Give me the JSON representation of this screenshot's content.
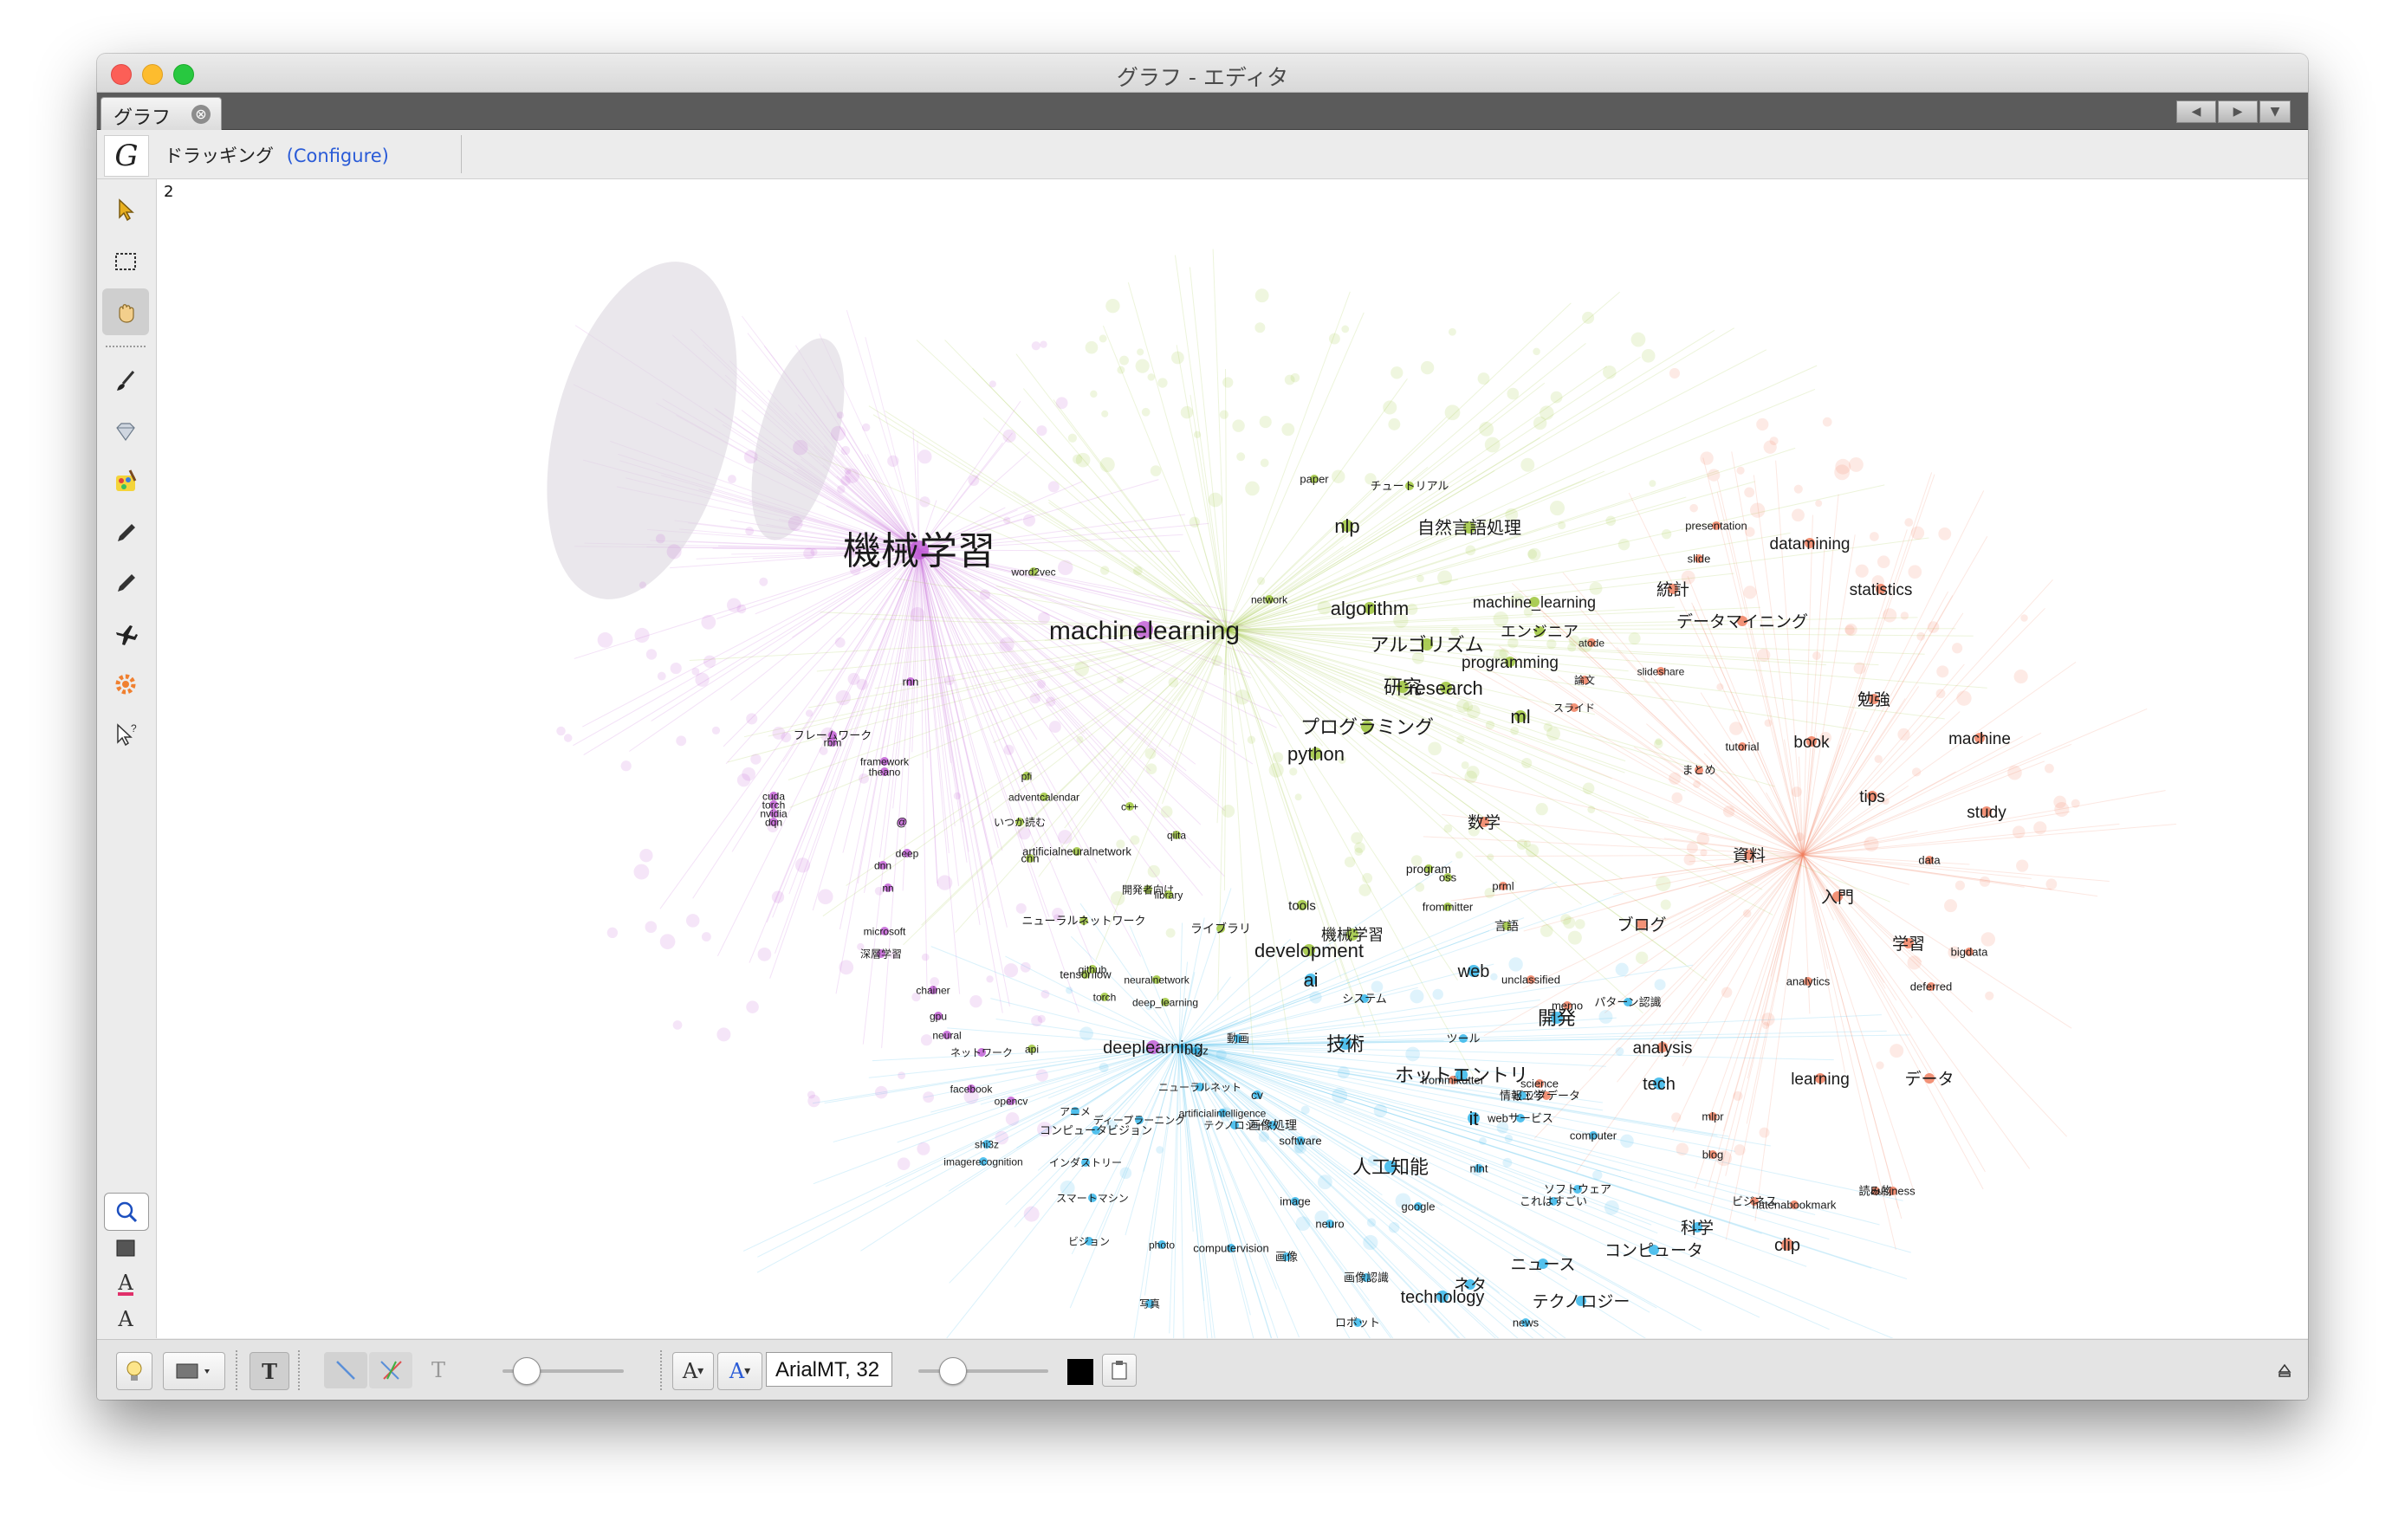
{
  "window": {
    "title": "グラフ - エディタ"
  },
  "tabs": [
    {
      "label": "グラフ",
      "close": "⊗"
    }
  ],
  "tab_nav": {
    "prev": "◀",
    "next": "▶",
    "menu": "▼"
  },
  "mode_bar": {
    "mode": "ドラッギング",
    "configure": "(Configure)"
  },
  "canvas": {
    "corner_label": "2"
  },
  "tools": {
    "left": [
      "pointer-icon",
      "rectangle-select-icon",
      "hand-drag-icon",
      "paintbrush-icon",
      "diamond-icon",
      "color-palette-icon",
      "pencil-icon",
      "pencil-icon",
      "airplane-icon",
      "gear-icon",
      "cursor-help-icon"
    ],
    "left_bottom": [
      "zoom-icon",
      "rectangle-icon",
      "text-color-icon",
      "text-style-icon"
    ]
  },
  "bottom": {
    "font_smaller": "A",
    "font_larger": "A",
    "font": "ArialMT, 32",
    "text_btn": "T",
    "text_btn2": "T"
  },
  "colors": {
    "purple": "#c25fd6",
    "green": "#9cc43a",
    "red": "#f07f5f",
    "blue": "#35b6ea"
  },
  "graph_labels": {
    "purple": [
      "機械学習",
      "machinelearning",
      "rnn",
      "フレームワーク",
      "rbm",
      "framework",
      "theano",
      "cuda",
      "torch",
      "nvidia",
      "dqn",
      "@",
      "deep",
      "dnn",
      "nn",
      "microsoft",
      "深層学習",
      "chainer",
      "gpu",
      "neural",
      "ネットワーク",
      "facebook",
      "opencv",
      "deeplearning"
    ],
    "green": [
      "paper",
      "チュートリアル",
      "nlp",
      "自然言語処理",
      "word2vec",
      "network",
      "algorithm",
      "machine_learning",
      "エンジニア",
      "アルゴリズム",
      "programming",
      "research",
      "ml",
      "プログラミング",
      "研究",
      "python",
      "pfi",
      "adventcalendar",
      "いつか読む",
      "c++",
      "qiita",
      "cnn",
      "artificialneuralnetwork",
      "開発者向け",
      "library",
      "tools",
      "ニューラルネットワーク",
      "ライブラリ",
      "機械学習",
      "development",
      "tensorflow",
      "frommitter",
      "neuralnetwork",
      "deep_learning",
      "torch",
      "github",
      "api",
      "oss",
      "program",
      "言語"
    ],
    "red": [
      "presentation",
      "datamining",
      "slide",
      "統計",
      "statistics",
      "データマイニング",
      "atode",
      "論文",
      "slideshare",
      "勉強",
      "スライド",
      "tutorial",
      "まとめ",
      "book",
      "machine",
      "tips",
      "study",
      "数学",
      "資料",
      "data",
      "入門",
      "prml",
      "ブログ",
      "学習",
      "bigdata",
      "analytics",
      "deferred",
      "memo",
      "analysis",
      "learning",
      "データ",
      "ビッグデータ",
      "mlpr",
      "blog",
      "読み物",
      "business",
      "ビジネス",
      "hatenabookmark",
      "clip",
      "science",
      "frommikutter",
      "unclassified"
    ],
    "blue": [
      "web",
      "ai",
      "システム",
      "パターン認識",
      "開発",
      "ツール",
      "技術",
      "ホットエントリ",
      "情報工学",
      "tech",
      "it",
      "webサービス",
      "computer",
      "buzz",
      "ニューラルネット",
      "cv",
      "アニメ",
      "ディープラーニング",
      "テクノロジー",
      "コンピュータビジョン",
      "artificialintelligence",
      "画像処理",
      "software",
      "インダストリー",
      "imagerecognition",
      "shi3z",
      "人工知能",
      "nlnt",
      "これはすごい",
      "ソフトウェア",
      "スマートマシン",
      "image",
      "google",
      "neuro",
      "科学",
      "ビジョン",
      "photo",
      "computervision",
      "画像",
      "コンピュータ",
      "画像認識",
      "ニュース",
      "ネタ",
      "technology",
      "テクノロジー",
      "写真",
      "ロボット",
      "news",
      "動画"
    ]
  }
}
